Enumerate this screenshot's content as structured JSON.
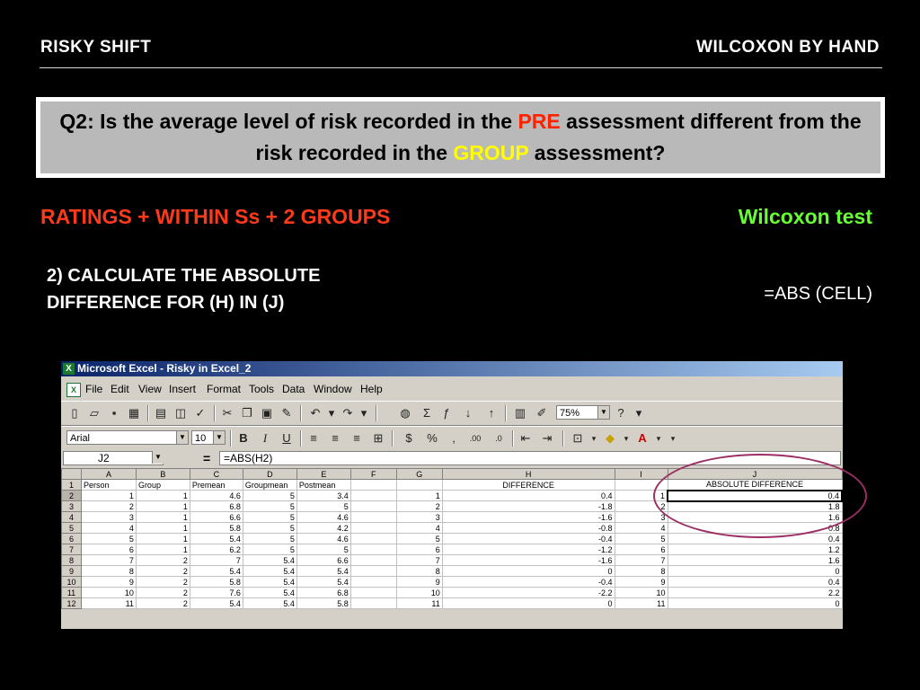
{
  "slide": {
    "header_left": "RISKY SHIFT",
    "header_right": "WILCOXON BY HAND",
    "question": {
      "part1": "Q2: Is the average level of risk recorded in the ",
      "pre": "PRE",
      "part2": " assessment different from the risk recorded in the ",
      "group": "GROUP",
      "part3": " assessment?"
    },
    "ratings_label": "RATINGS + WITHIN Ss + 2 GROUPS",
    "test_label": "Wilcoxon test",
    "step_text": "2) CALCULATE THE ABSOLUTE DIFFERENCE FOR (H) IN (J)",
    "formula_hint": "=ABS (CELL)",
    "colors": {
      "pre": "#ff2200",
      "group": "#ffff00",
      "ratings": "#ff3a1a",
      "test": "#66ff33",
      "circle": "#9b2f63"
    }
  },
  "excel": {
    "title": "Microsoft Excel - Risky in Excel_2",
    "menu": [
      "File",
      "Edit",
      "View",
      "Insert",
      "Format",
      "Tools",
      "Data",
      "Window",
      "Help"
    ],
    "zoom": "75%",
    "font_name": "Arial",
    "font_size": "10",
    "name_box": "J2",
    "formula_eq": "=",
    "formula": "=ABS(H2)",
    "columns": [
      "A",
      "B",
      "C",
      "D",
      "E",
      "F",
      "G",
      "H",
      "I",
      "J"
    ],
    "rows": [
      [
        "1",
        "Person",
        "Group",
        "Premean",
        "Groupmean",
        "Postmean",
        "",
        "",
        "DIFFERENCE",
        "",
        "ABSOLUTE DIFFERENCE"
      ],
      [
        "2",
        "1",
        "1",
        "4.6",
        "5",
        "3.4",
        "",
        "1",
        "0.4",
        "1",
        "0.4"
      ],
      [
        "3",
        "2",
        "1",
        "6.8",
        "5",
        "5",
        "",
        "2",
        "-1.8",
        "2",
        "1.8"
      ],
      [
        "4",
        "3",
        "1",
        "6.6",
        "5",
        "4.6",
        "",
        "3",
        "-1.6",
        "3",
        "1.6"
      ],
      [
        "5",
        "4",
        "1",
        "5.8",
        "5",
        "4.2",
        "",
        "4",
        "-0.8",
        "4",
        "0.8"
      ],
      [
        "6",
        "5",
        "1",
        "5.4",
        "5",
        "4.6",
        "",
        "5",
        "-0.4",
        "5",
        "0.4"
      ],
      [
        "7",
        "6",
        "1",
        "6.2",
        "5",
        "5",
        "",
        "6",
        "-1.2",
        "6",
        "1.2"
      ],
      [
        "8",
        "7",
        "2",
        "7",
        "5.4",
        "6.6",
        "",
        "7",
        "-1.6",
        "7",
        "1.6"
      ],
      [
        "9",
        "8",
        "2",
        "5.4",
        "5.4",
        "5.4",
        "",
        "8",
        "0",
        "8",
        "0"
      ],
      [
        "10",
        "9",
        "2",
        "5.8",
        "5.4",
        "5.4",
        "",
        "9",
        "-0.4",
        "9",
        "0.4"
      ],
      [
        "11",
        "10",
        "2",
        "7.6",
        "5.4",
        "6.8",
        "",
        "10",
        "-2.2",
        "10",
        "2.2"
      ],
      [
        "12",
        "11",
        "2",
        "5.4",
        "5.4",
        "5.8",
        "",
        "11",
        "0",
        "11",
        "0"
      ]
    ]
  }
}
